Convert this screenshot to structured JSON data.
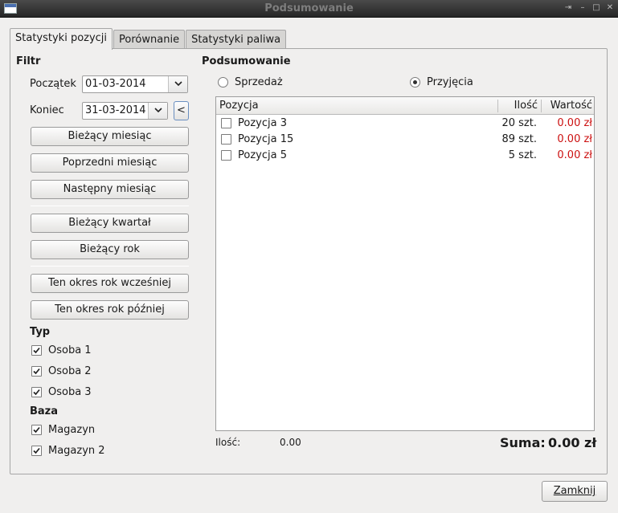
{
  "window": {
    "title": "Podsumowanie"
  },
  "tabs": [
    {
      "label": "Statystyki pozycji",
      "active": true
    },
    {
      "label": "Porównanie",
      "active": false
    },
    {
      "label": "Statystyki paliwa",
      "active": false
    }
  ],
  "filter": {
    "title": "Filtr",
    "start_label": "Początek",
    "start_value": "01-03-2014",
    "end_label": "Koniec",
    "end_value": "31-03-2014",
    "prev_button": "<",
    "buttons": {
      "current_month": "Bieżący miesiąc",
      "prev_month": "Poprzedni miesiąc",
      "next_month": "Następny miesiąc",
      "current_quarter": "Bieżący kwartał",
      "current_year": "Bieżący rok",
      "year_earlier": "Ten okres rok wcześniej",
      "year_later": "Ten okres rok później"
    }
  },
  "type_group": {
    "title": "Typ",
    "items": [
      {
        "label": "Osoba 1",
        "checked": true
      },
      {
        "label": "Osoba 2",
        "checked": true
      },
      {
        "label": "Osoba 3",
        "checked": true
      }
    ]
  },
  "base_group": {
    "title": "Baza",
    "items": [
      {
        "label": "Magazyn",
        "checked": true
      },
      {
        "label": "Magazyn 2",
        "checked": true
      }
    ]
  },
  "summary": {
    "title": "Podsumowanie",
    "radio_sale": "Sprzedaż",
    "radio_receipts": "Przyjęcia",
    "selected": "Przyjęcia",
    "columns": [
      "Pozycja",
      "Ilość",
      "Wartość"
    ],
    "rows": [
      {
        "name": "Pozycja 3",
        "qty": "20 szt.",
        "value": "0.00 zł"
      },
      {
        "name": "Pozycja 15",
        "qty": "89 szt.",
        "value": "0.00 zł"
      },
      {
        "name": "Pozycja 5",
        "qty": "5 szt.",
        "value": "0.00 zł"
      }
    ],
    "qty_label": "Ilość:",
    "qty_value": "0.00",
    "sum_label": "Suma:",
    "sum_value": "0.00 zł"
  },
  "close_button": "Zamknij",
  "colors": {
    "value_red": "#cc1010",
    "titlebar": "#333333"
  }
}
